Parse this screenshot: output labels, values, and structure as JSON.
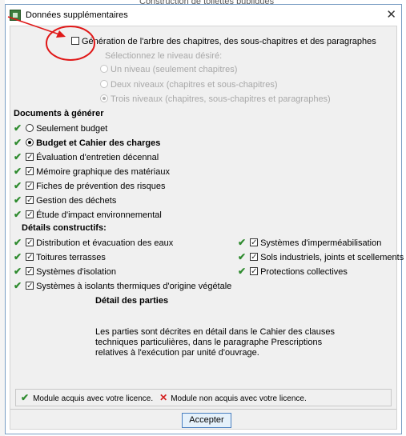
{
  "background": {
    "window_title": "Construction de toilettes publiques"
  },
  "dialog": {
    "title": "Données supplémentaires",
    "close_icon": "close-icon",
    "generation": {
      "label": "Génération de l'arbre des chapitres, des sous-chapitres et des paragraphes",
      "checked": false,
      "select_level_label": "Sélectionnez le niveau désiré:",
      "levels": [
        {
          "label": "Un niveau (seulement chapitres)",
          "selected": false
        },
        {
          "label": "Deux niveaux (chapitres et sous-chapitres)",
          "selected": false
        },
        {
          "label": "Trois niveaux (chapitres, sous-chapitres et paragraphes)",
          "selected": true
        }
      ]
    },
    "documents": {
      "heading": "Documents à générer",
      "items": [
        {
          "label": "Seulement budget",
          "control": "radio",
          "checked": false,
          "bold": false
        },
        {
          "label": "Budget et Cahier des charges",
          "control": "radio",
          "checked": true,
          "bold": true
        },
        {
          "label": "Évaluation d'entretien décennal",
          "control": "checkbox",
          "checked": true
        },
        {
          "label": "Mémoire graphique des matériaux",
          "control": "checkbox",
          "checked": true
        },
        {
          "label": "Fiches de prévention des risques",
          "control": "checkbox",
          "checked": true
        },
        {
          "label": "Gestion des déchets",
          "control": "checkbox",
          "checked": true
        },
        {
          "label": "Étude d'impact environnemental",
          "control": "checkbox",
          "checked": true
        }
      ]
    },
    "constructive": {
      "heading": "Détails constructifs:",
      "left": [
        {
          "label": "Distribution et évacuation des eaux",
          "checked": true
        },
        {
          "label": "Toitures terrasses",
          "checked": true
        },
        {
          "label": "Systèmes d'isolation",
          "checked": true
        },
        {
          "label": "Systèmes à isolants thermiques d'origine végétale",
          "checked": true
        }
      ],
      "right": [
        {
          "label": "Systèmes d'imperméabilisation",
          "checked": true
        },
        {
          "label": "Sols industriels, joints et scellements",
          "checked": true
        },
        {
          "label": "Protections collectives",
          "checked": true
        }
      ]
    },
    "parts": {
      "heading": "Détail des parties",
      "description": "Les parties sont décrites en détail dans le Cahier des clauses techniques particulières, dans le paragraphe Prescriptions relatives à l'exécution par unité d'ouvrage."
    },
    "legend": {
      "acquired": "Module acquis avec votre licence.",
      "not_acquired": "Module non acquis avec votre licence."
    },
    "accept_label": "Accepter"
  },
  "colors": {
    "acquired_check": "#2e8b2e",
    "not_acquired_cross": "#d42020",
    "annotation": "#e01818"
  }
}
